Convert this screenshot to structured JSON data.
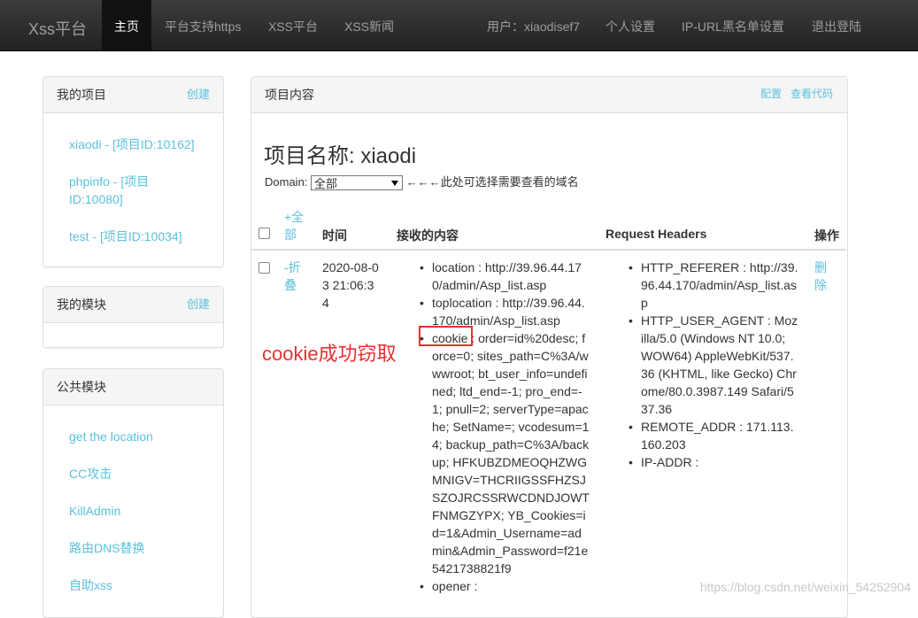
{
  "navbar": {
    "brand": "Xss平台",
    "items": [
      "主页",
      "平台支持https",
      "XSS平台",
      "XSS新闻"
    ],
    "user_label": "用户：xiaodisef7",
    "settings": "个人设置",
    "blacklist": "IP-URL黑名单设置",
    "logout": "退出登陆"
  },
  "sidebar": {
    "projects": {
      "title": "我的项目",
      "action": "创建",
      "items": [
        "xiaodi - [项目ID:10162]",
        "phpinfo - [项目ID:10080]",
        "test - [项目ID:10034]"
      ]
    },
    "modules": {
      "title": "我的模块",
      "action": "创建"
    },
    "public_modules": {
      "title": "公共模块",
      "items": [
        "get the location",
        "CC攻击",
        "KillAdmin",
        "路由DNS替换",
        "自助xss"
      ]
    }
  },
  "main": {
    "heading": "项目内容",
    "config_link": "配置",
    "view_code_link": "查看代码",
    "project_title": "项目名称: xiaodi",
    "domain_label": "Domain:",
    "domain_value": "全部",
    "domain_hint": "←←←此处可选择需要查看的域名",
    "table": {
      "headers": {
        "expand_all": "+全部",
        "time": "时间",
        "content": "接收的内容",
        "headers": "Request Headers",
        "ops": "操作"
      },
      "row": {
        "collapse": "-折叠",
        "time": "2020-08-03 21:06:34",
        "content": [
          "location : http://39.96.44.170/admin/Asp_list.asp",
          "toplocation : http://39.96.44.170/admin/Asp_list.asp",
          "cookie : order=id%20desc; force=0; sites_path=C%3A/wwwroot; bt_user_info=undefined; ltd_end=-1; pro_end=-1; pnull=2; serverType=apache; SetName=; vcodesum=14; backup_path=C%3A/backup; HFKUBZDMEOQHZWGMNIGV=THCRIIGSSFHZSJSZOJRCSSRWCDNDJOWTFNMGZYPX; YB_Cookies=id=1&Admin_Username=admin&Admin_Password=f21e5421738821f9",
          "opener :"
        ],
        "headers": [
          "HTTP_REFERER : http://39.96.44.170/admin/Asp_list.asp",
          "HTTP_USER_AGENT : Mozilla/5.0 (Windows NT 10.0; WOW64) AppleWebKit/537.36 (KHTML, like Gecko) Chrome/80.0.3987.149 Safari/537.36",
          "REMOTE_ADDR : 171.113.160.203",
          "IP-ADDR :"
        ],
        "delete": "删除"
      }
    }
  },
  "annotation": {
    "text": "cookie成功窃取"
  },
  "watermark": "https://blog.csdn.net/weixin_54252904",
  "colors": {
    "link": "#5bc0de",
    "annotation": "#e53333",
    "navbar": "#222222"
  }
}
